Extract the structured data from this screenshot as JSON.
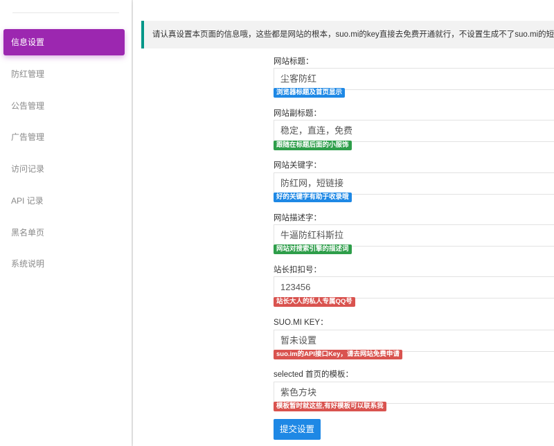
{
  "sidebar": {
    "items": [
      {
        "label": "信息设置",
        "active": true
      },
      {
        "label": "防红管理"
      },
      {
        "label": "公告管理"
      },
      {
        "label": "广告管理"
      },
      {
        "label": "访问记录"
      },
      {
        "label": "API 记录"
      },
      {
        "label": "黑名单页"
      },
      {
        "label": "系统说明"
      }
    ]
  },
  "notice": {
    "text": "请认真设置本页面的信息哦，这些都是网站的根本，suo.mi的key直接去免费开通就行，不设置生成不了suo.mi的短链接！"
  },
  "form": {
    "fields": [
      {
        "label": "网站标题：",
        "value": "尘客防红",
        "hint": "浏览器标题及首页显示",
        "hint_color": "#1e88e5"
      },
      {
        "label": "网站副标题：",
        "value": "稳定，直连，免费",
        "hint": "跟随在标题后面的小服饰",
        "hint_color": "#2e9e4a"
      },
      {
        "label": "网站关键字：",
        "value": "防红网，短链接",
        "hint": "好的关键字有助于收录哦",
        "hint_color": "#1e88e5"
      },
      {
        "label": "网站描述字：",
        "value": "牛逼防红科斯拉",
        "hint": "网站对搜索引擎的描述词",
        "hint_color": "#2e9e4a"
      },
      {
        "label": "站长扣扣号：",
        "value": "123456",
        "hint": "站长大人的私人专属QQ号",
        "hint_color": "#d9534f"
      },
      {
        "label": "SUO.MI KEY：",
        "value": "暂未设置",
        "hint": "suo.im的API接口Key，请去网站免费申请",
        "hint_color": "#d9534f"
      },
      {
        "label": "selected 首页的模板：",
        "value": "紫色方块",
        "hint": "模板暂时就这些,有好模板可以联系我",
        "hint_color": "#d9534f"
      }
    ],
    "submit_label": "提交设置"
  }
}
